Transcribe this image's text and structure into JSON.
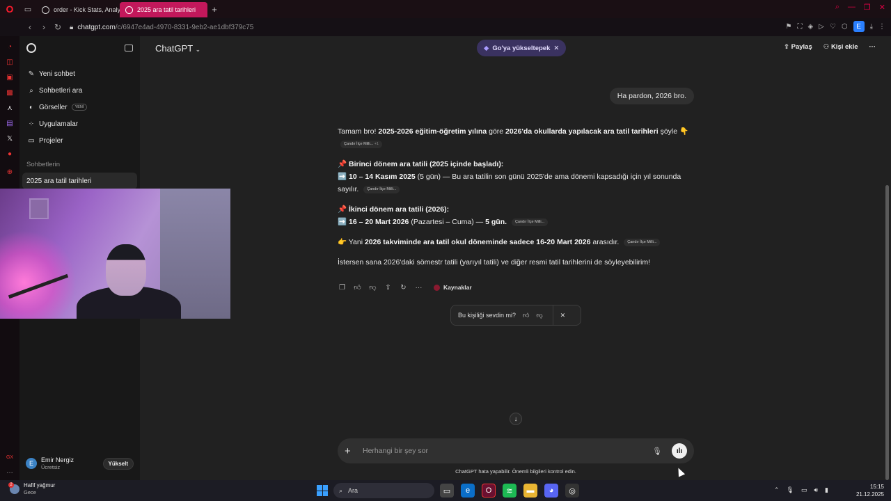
{
  "browser": {
    "tabs": [
      {
        "label": "order - Kick Stats, Analyt",
        "active": false
      },
      {
        "label": "2025 ara tatil tarihleri",
        "active": true
      }
    ],
    "new_tab_symbol": "+",
    "url_host": "chatgpt.com",
    "url_path": "/c/6947e4ad-4970-8331-9eb2-ae1dbf379c75",
    "profile_initial": "E",
    "accent_color": "#c2185b"
  },
  "sidebar": {
    "nav": [
      {
        "label": "Yeni sohbet",
        "icon": "edit-icon"
      },
      {
        "label": "Sohbetleri ara",
        "icon": "search-icon"
      },
      {
        "label": "Görseller",
        "icon": "image-icon",
        "badge": "YENİ"
      },
      {
        "label": "Uygulamalar",
        "icon": "grid-icon"
      },
      {
        "label": "Projeler",
        "icon": "folder-icon"
      }
    ],
    "section_title": "Sohbetlerin",
    "chats": [
      "2025 ara tatil tarihleri"
    ],
    "user": {
      "initial": "E",
      "name": "Emir Nergiz",
      "plan": "Ücretsiz",
      "upgrade_label": "Yükselt"
    }
  },
  "header": {
    "model": "ChatGPT",
    "upsell": "Go'ya yükseltерek",
    "share": "Paylaş",
    "add_person": "Kişi ekle"
  },
  "conversation": {
    "user_message": "Ha pardon, 2026 bro.",
    "citation": "Çandır İlçe Milli...",
    "citation_extra": "+1",
    "p1_a": "Tamam bro! ",
    "p1_b": "2025-2026 eğitim-öğretim yılına",
    "p1_c": " göre ",
    "p1_d": "2026'da okullarda yapılacak ara tatil tarihleri",
    "p1_e": " şöyle 👇",
    "s1_title": "📌 Birinci dönem ara tatili (2025 içinde başladı):",
    "s1_a": "➡️ ",
    "s1_b": "10 – 14 Kasım 2025",
    "s1_c": " (5 gün) — Bu ara tatilin son günü 2025'de ama dönemi kapsadığı için yıl sonunda sayılır.",
    "s2_title": "📌 İkinci dönem ara tatili (2026):",
    "s2_a": "➡️ ",
    "s2_b": "16 – 20 Mart 2026",
    "s2_c": " (Pazartesi – Cuma) — ",
    "s2_d": "5 gün.",
    "p3_a": "👉 Yani ",
    "p3_b": "2026 takviminde ara tatil okul döneminde sadece 16-20 Mart 2026",
    "p3_c": " arasıdır.",
    "p4": "İstersen sana 2026'daki sömestr tatili (yarıyıl tatili) ve diğer resmi tatil tarihlerini de söyleyebilirim!",
    "sources_label": "Kaynaklar"
  },
  "feedback": {
    "question": "Bu kişiliği sevdin mi?"
  },
  "composer": {
    "placeholder": "Herhangi bir şey sor",
    "disclaimer": "ChatGPT hata yapabilir. Önemli bilgileri kontrol edin."
  },
  "taskbar": {
    "weather_title": "Hafif yağmur",
    "weather_sub": "Gece",
    "weather_badge": "2",
    "search_label": "Ara",
    "time": "15:15",
    "date": "21.12.2025"
  }
}
